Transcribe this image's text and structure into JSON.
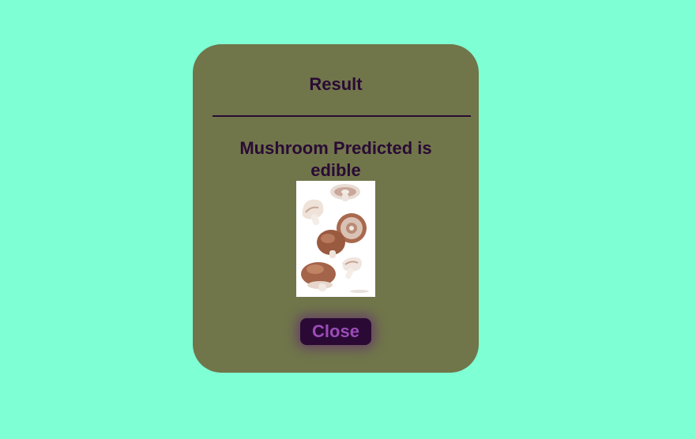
{
  "dialog": {
    "title": "Result",
    "prediction_text": "Mushroom Predicted is edible",
    "image_subject": "mushrooms",
    "close_label": "Close"
  },
  "colors": {
    "page_background": "#7fffd4",
    "card_background": "#70764a",
    "text": "#2a0a35",
    "button_background": "#2a0a35",
    "button_text": "#9b4bb8",
    "button_glow": "#5f1e78"
  }
}
